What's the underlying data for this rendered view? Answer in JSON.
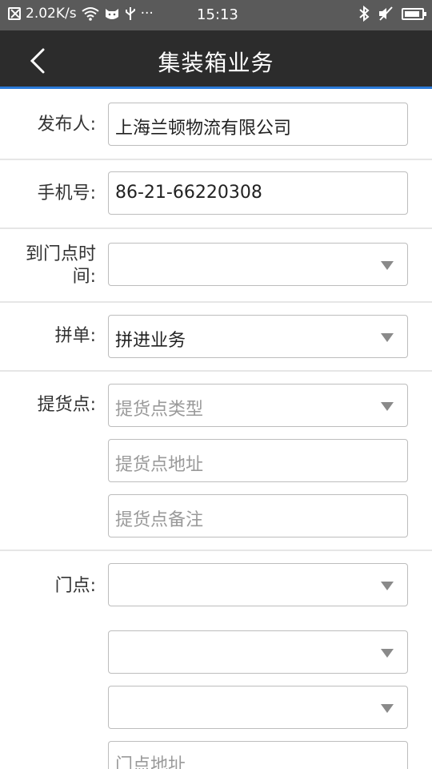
{
  "status_bar": {
    "speed": "2.02K/s",
    "extra": "···",
    "time": "15:13",
    "battery_level": 0.9
  },
  "header": {
    "title": "集装箱业务"
  },
  "form": {
    "publisher": {
      "label": "发布人:",
      "value": "上海兰顿物流有限公司"
    },
    "phone": {
      "label": "手机号:",
      "value": "86-21-66220308"
    },
    "arrival_time": {
      "label_line1": "到门点时",
      "label_line2": "间:",
      "value": ""
    },
    "consolidation": {
      "label": "拼单:",
      "value": "拼进业务"
    },
    "pickup": {
      "label": "提货点:",
      "type_placeholder": "提货点类型",
      "address_placeholder": "提货点地址",
      "remark_placeholder": "提货点备注"
    },
    "door": {
      "label": "门点:",
      "select1": "",
      "select2": "",
      "select3": "",
      "address_placeholder": "门点地址"
    }
  }
}
